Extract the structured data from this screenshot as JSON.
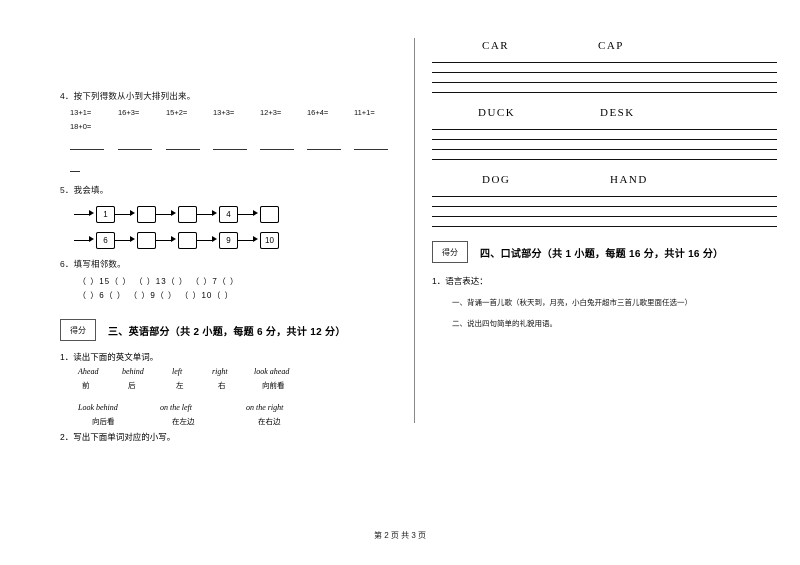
{
  "left": {
    "q4": {
      "label": "4．按下列得数从小到大排列出来。",
      "expressions": [
        "13+1=",
        "16+3=",
        "15+2=",
        "13+3=",
        "12+3=",
        "16+4=",
        "11+1=",
        "18+0="
      ],
      "blanks": 7
    },
    "q5": {
      "label": "5．我会填。",
      "row1": [
        "1",
        "",
        "",
        "4",
        ""
      ],
      "row2": [
        "6",
        "",
        "",
        "9",
        "10"
      ]
    },
    "q6": {
      "label": "6．填写相邻数。",
      "line1": "（  ）15（  ）        （  ）13（  ）        （  ）7（  ）",
      "line2": "（  ）6（  ）          （  ）9（  ）          （  ）10（  ）"
    },
    "section3": {
      "stamp": "得分",
      "title": "三、英语部分（共 2 小题，每题 6 分，共计 12 分）",
      "q1": "1．读出下面的英文单词。",
      "words_row1": [
        {
          "en": "Ahead",
          "cn": "前"
        },
        {
          "en": "behind",
          "cn": "后"
        },
        {
          "en": "left",
          "cn": "左"
        },
        {
          "en": "right",
          "cn": "右"
        },
        {
          "en": "look ahead",
          "cn": "向前看"
        }
      ],
      "words_row2": [
        {
          "en": "Look behind",
          "cn": "向后看"
        },
        {
          "en": "on the left",
          "cn": "在左边"
        },
        {
          "en": "on the right",
          "cn": "在右边"
        }
      ],
      "q2": "2．写出下面单词对应的小写。"
    }
  },
  "right": {
    "word_pairs": [
      {
        "left": "CAR",
        "right": "CAP"
      },
      {
        "left": "DUCK",
        "right": "DESK"
      },
      {
        "left": "DOG",
        "right": "HAND"
      }
    ],
    "section4": {
      "stamp": "得分",
      "title": "四、口试部分（共 1 小题，每题 16 分，共计 16 分）",
      "q1": "1．语言表达：",
      "item1": "一、背诵一首儿歌（秋天到，月亮，小白兔开超市三首儿歌里面任选一）",
      "item2": "二、说出四句简单的礼貌用语。"
    }
  },
  "footer": "第 2 页 共 3 页"
}
